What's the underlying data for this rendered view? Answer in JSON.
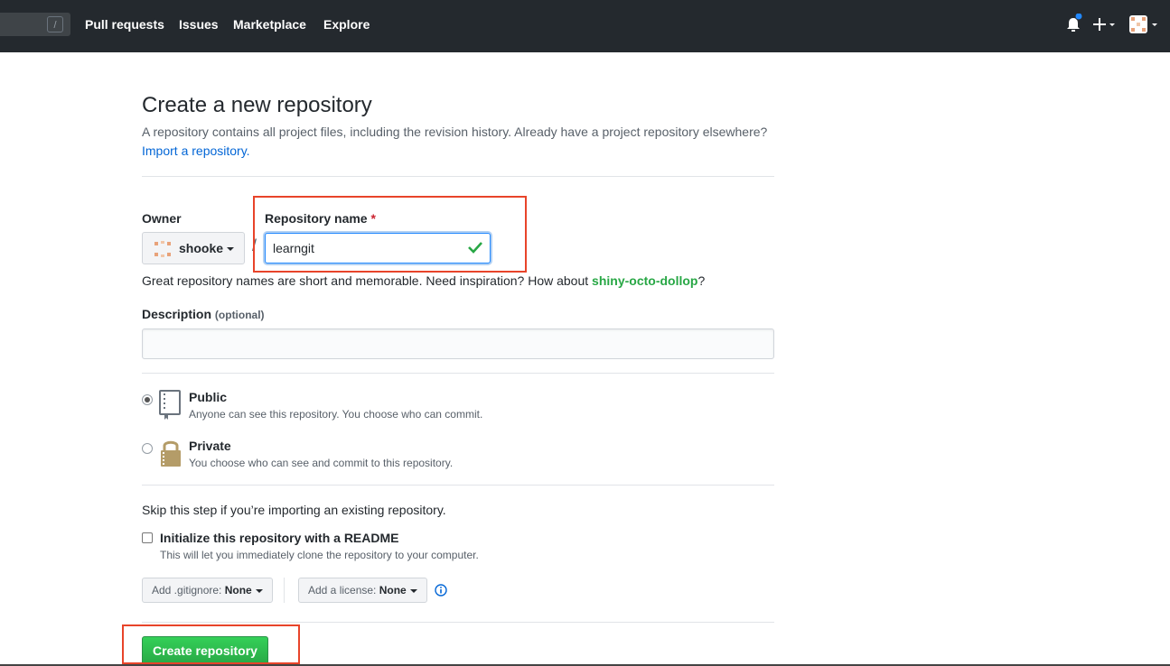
{
  "header": {
    "search_key": "/",
    "nav": [
      "Pull requests",
      "Issues",
      "Marketplace",
      "Explore"
    ]
  },
  "page": {
    "title": "Create a new repository",
    "subtitle": "A repository contains all project files, including the revision history. Already have a project repository elsewhere?",
    "import_link": "Import a repository."
  },
  "form": {
    "owner_label": "Owner",
    "owner_value": "shooke",
    "separator": "/",
    "repo_name_label": "Repository name",
    "required_mark": "*",
    "repo_name_value": "learngit",
    "hint_prefix": "Great repository names are short and memorable. Need inspiration? How about",
    "hint_suggestion": "shiny-octo-dollop",
    "hint_suffix": "?",
    "description_label": "Description",
    "description_optional": "(optional)",
    "description_value": "",
    "visibility": [
      {
        "title": "Public",
        "desc": "Anyone can see this repository. You choose who can commit.",
        "checked": true
      },
      {
        "title": "Private",
        "desc": "You choose who can see and commit to this repository.",
        "checked": false
      }
    ],
    "skip_text": "Skip this step if you’re importing an existing repository.",
    "readme_label": "Initialize this repository with a README",
    "readme_desc": "This will let you immediately clone the repository to your computer.",
    "gitignore_label": "Add .gitignore:",
    "gitignore_value": "None",
    "license_label": "Add a license:",
    "license_value": "None",
    "submit_label": "Create repository"
  },
  "colors": {
    "header_bg": "#24292e",
    "link": "#0366d6",
    "success": "#28a745",
    "highlight": "#e8442a"
  }
}
